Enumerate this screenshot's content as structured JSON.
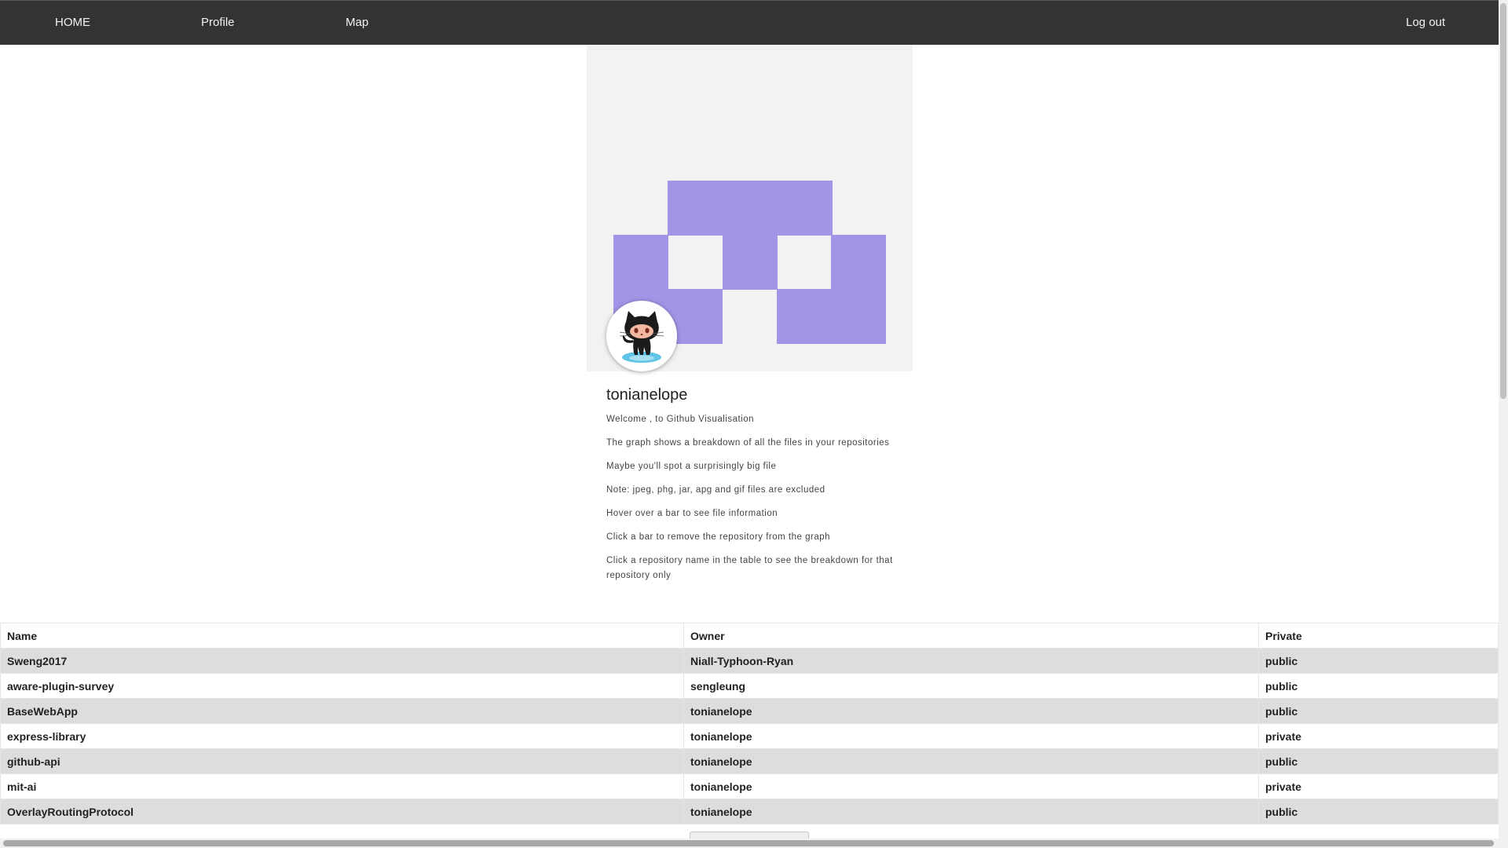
{
  "nav": {
    "home": "HOME",
    "profile": "Profile",
    "map": "Map",
    "logout": "Log out"
  },
  "profile": {
    "username": "tonianelope",
    "identicon_color": "#a294e6",
    "avatar_icon": "github-octocat-icon",
    "lines": [
      "Welcome , to Github Visualisation",
      "The graph shows a breakdown of all the files in your repositories",
      "Maybe you'll spot a surprisingly big file",
      "Note: jpeg, phg, jar, apg and gif files are excluded",
      "Hover over a bar to see file information",
      "Click a bar to remove the repository from the graph",
      "Click a repository name in the table to see the breakdown for that repository only"
    ]
  },
  "table": {
    "headers": [
      "Name",
      "Owner",
      "Private"
    ],
    "rows": [
      [
        "Sweng2017",
        "Niall-Typhoon-Ryan",
        "public"
      ],
      [
        "aware-plugin-survey",
        "sengleung",
        "public"
      ],
      [
        "BaseWebApp",
        "tonianelope",
        "public"
      ],
      [
        "express-library",
        "tonianelope",
        "private"
      ],
      [
        "github-api",
        "tonianelope",
        "public"
      ],
      [
        "mit-ai",
        "tonianelope",
        "private"
      ],
      [
        "OverlayRoutingProtocol",
        "tonianelope",
        "public"
      ]
    ]
  }
}
